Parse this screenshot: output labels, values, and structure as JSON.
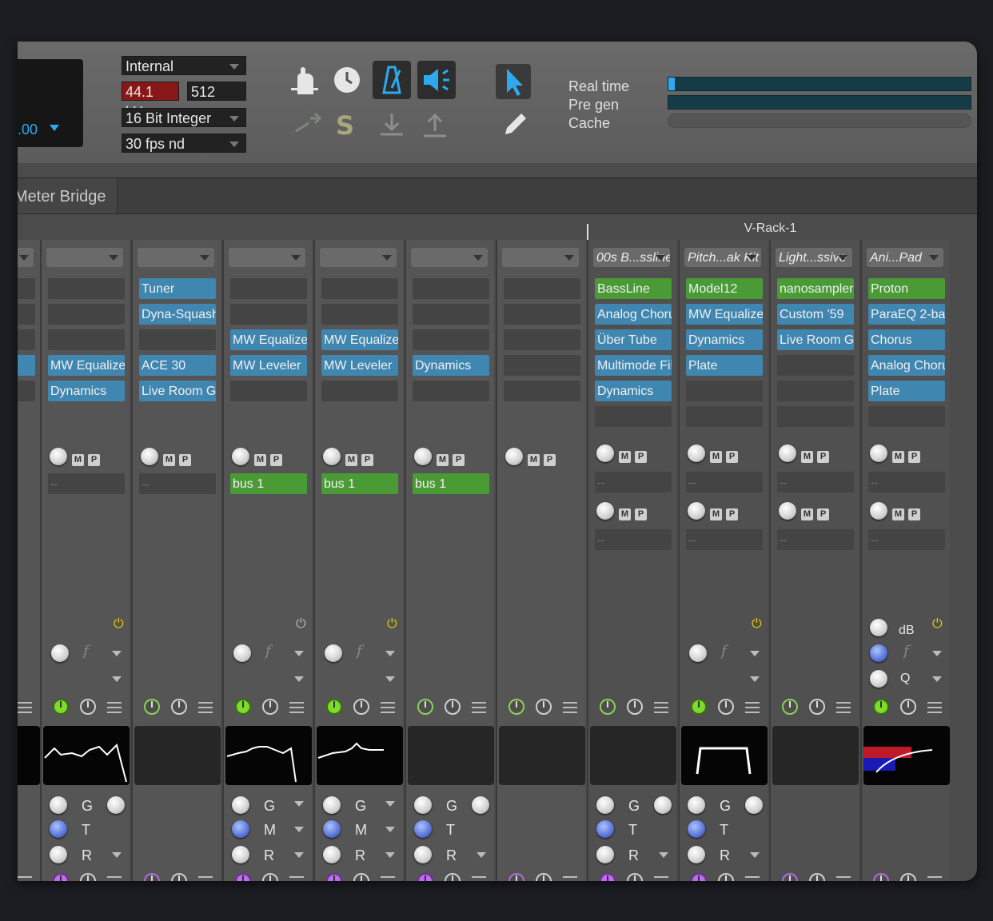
{
  "transport": {
    "time_value": ".00",
    "clock_source": "Internal",
    "sample_rate": "44.1 kHz",
    "buffer_size": "512",
    "bit_depth": "16 Bit Integer",
    "frame_rate": "30 fps nd"
  },
  "performance": {
    "real_time_label": "Real time",
    "pre_gen_label": "Pre gen",
    "cache_label": "Cache",
    "real_time_level": 0.02,
    "pre_gen_level": 1.0,
    "cache_level": 0.0
  },
  "tabs": {
    "meter_bridge": "Meter Bridge"
  },
  "vrack": {
    "title": "V-Rack-1"
  },
  "icons": [
    "hand-icon",
    "clock-icon",
    "metronome-icon",
    "speaker-icon",
    "pointer-icon",
    "pencil-icon",
    "arrow-right-icon",
    "s-icon",
    "download-icon",
    "upload-icon"
  ],
  "colors": {
    "accent_blue": "#2ea9f0",
    "slot_blue": "#3f86b0",
    "slot_green": "#4a9a36",
    "sample_rate_bg": "#8a1717"
  },
  "strips": [
    {
      "fx": [
        "",
        "",
        "",
        "ze",
        ""
      ],
      "send": "",
      "bus": ""
    },
    {
      "fx": [
        "",
        "",
        "",
        "MW Equalize",
        "Dynamics"
      ],
      "send": "--"
    },
    {
      "fx": [
        "Tuner",
        "Dyna-Squash",
        "",
        "ACE 30",
        "Live Room G"
      ],
      "send": "--"
    },
    {
      "fx": [
        "",
        "",
        "MW Equalize",
        "MW Leveler",
        ""
      ],
      "send": "bus 1"
    },
    {
      "fx": [
        "",
        "",
        "MW Equalize",
        "MW Leveler",
        ""
      ],
      "send": "bus 1"
    },
    {
      "fx": [
        "",
        "",
        "",
        "Dynamics",
        ""
      ],
      "send": "bus 1"
    },
    {
      "fx": [
        "",
        "",
        "",
        "",
        ""
      ],
      "send": ""
    }
  ],
  "vrack_strips": [
    {
      "instrument": "00s B...ssline",
      "fx": [
        "BassLine",
        "Analog Choru",
        "Über Tube",
        "Multimode Fil",
        "Dynamics",
        ""
      ],
      "send1": "--",
      "send2": "--"
    },
    {
      "instrument": "Pitch...ak Kit",
      "fx": [
        "Model12",
        "MW Equalize",
        "Dynamics",
        "Plate",
        "",
        ""
      ],
      "send1": "--",
      "send2": "--"
    },
    {
      "instrument": "Light...ssive",
      "fx": [
        "nanosampler",
        "Custom '59",
        "Live Room G",
        "",
        "",
        ""
      ],
      "send1": "--",
      "send2": "--"
    },
    {
      "instrument": "Ani...Pad",
      "fx": [
        "Proton",
        "ParaEQ 2-ba",
        "Chorus",
        "Analog Choru",
        "Plate",
        ""
      ],
      "send1": "--",
      "send2": "--"
    }
  ],
  "labels": {
    "M": "M",
    "P": "P",
    "G": "G",
    "T": "T",
    "R": "R",
    "Mm": "M",
    "dB": "dB",
    "Q": "Q",
    "f": "f"
  }
}
